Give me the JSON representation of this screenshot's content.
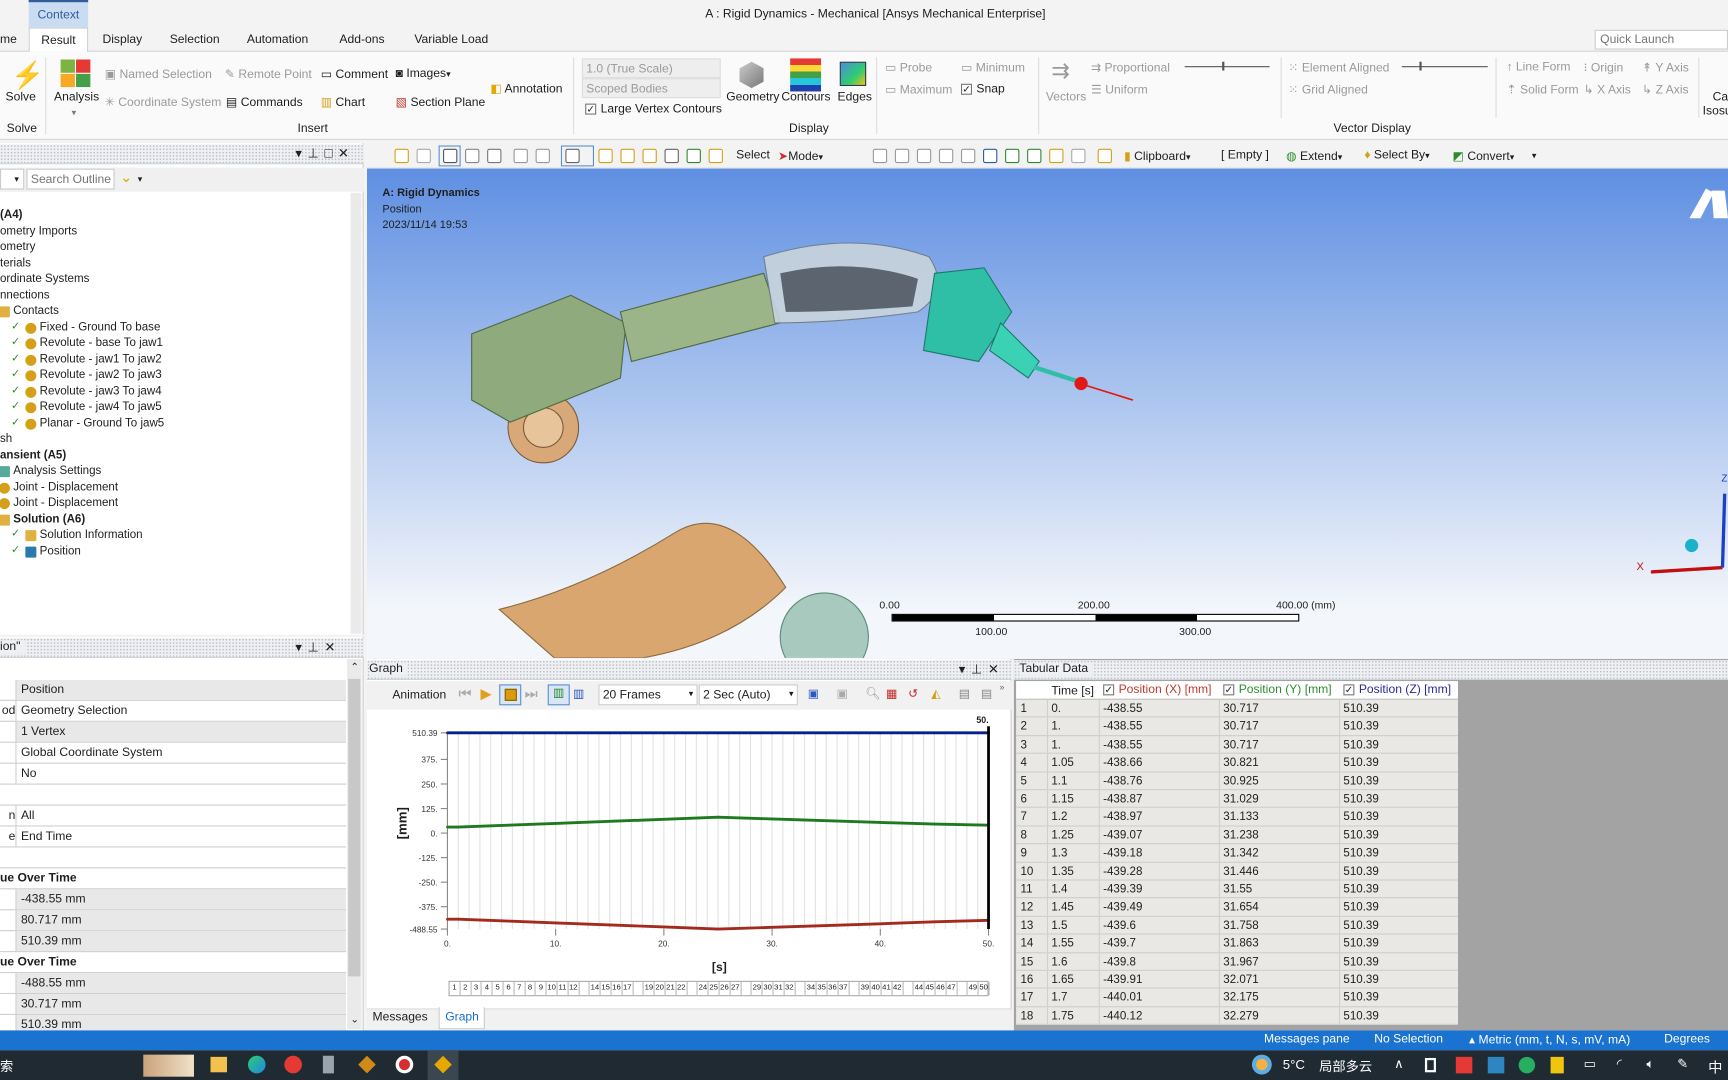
{
  "window": {
    "title": "A : Rigid Dynamics - Mechanical [Ansys Mechanical Enterprise]",
    "context_tab": "Context",
    "quick_launch_placeholder": "Quick Launch"
  },
  "ribbon_tabs": [
    "me",
    "Result",
    "Display",
    "Selection",
    "Automation",
    "Add-ons",
    "Variable Load"
  ],
  "ribbon": {
    "solve": "Solve",
    "solve_group": "Solve",
    "analysis": "Analysis",
    "named_selection": "Named Selection",
    "coordinate_system": "Coordinate System",
    "remote_point": "Remote Point",
    "commands": "Commands",
    "comment": "Comment",
    "chart": "Chart",
    "images": "Images",
    "section_plane": "Section Plane",
    "annotation": "Annotation",
    "insert_group": "Insert",
    "scale": "1.0 (True Scale)",
    "scoped_bodies": "Scoped Bodies",
    "large_vertex": "Large Vertex Contours",
    "geometry": "Geometry",
    "contours": "Contours",
    "edges": "Edges",
    "display_group": "Display",
    "probe": "Probe",
    "maximum": "Maximum",
    "minimum": "Minimum",
    "snap": "Snap",
    "vectors": "Vectors",
    "proportional": "Proportional",
    "uniform": "Uniform",
    "element_aligned": "Element Aligned",
    "grid_aligned": "Grid Aligned",
    "vector_display_group": "Vector Display",
    "line_form": "Line Form",
    "solid_form": "Solid Form",
    "origin": "Origin",
    "x_axis": "X Axis",
    "y_axis": "Y Axis",
    "z_axis": "Z Axis",
    "cap_1": "Ca",
    "cap_2": "Isosu"
  },
  "toolbar": {
    "select": "Select",
    "mode": "Mode",
    "clipboard": "Clipboard",
    "empty": "[ Empty ]",
    "extend": "Extend",
    "select_by": "Select By",
    "convert": "Convert"
  },
  "outline": {
    "search_placeholder": "Search Outline",
    "items": [
      {
        "label": "(A4)",
        "level": 0,
        "bold": true
      },
      {
        "label": "ometry Imports",
        "level": 0
      },
      {
        "label": "ometry",
        "level": 0
      },
      {
        "label": "terials",
        "level": 0
      },
      {
        "label": "ordinate Systems",
        "level": 0
      },
      {
        "label": "nnections",
        "level": 0
      },
      {
        "label": "Contacts",
        "level": 1,
        "icon": "folder"
      },
      {
        "label": "Fixed - Ground To base",
        "level": 2,
        "icon": "joint"
      },
      {
        "label": "Revolute - base To jaw1",
        "level": 2,
        "icon": "joint"
      },
      {
        "label": "Revolute - jaw1 To jaw2",
        "level": 2,
        "icon": "joint"
      },
      {
        "label": "Revolute - jaw2 To jaw3",
        "level": 2,
        "icon": "joint"
      },
      {
        "label": "Revolute - jaw3 To jaw4",
        "level": 2,
        "icon": "joint"
      },
      {
        "label": "Revolute - jaw4 To jaw5",
        "level": 2,
        "icon": "joint"
      },
      {
        "label": "Planar - Ground To jaw5",
        "level": 2,
        "icon": "joint"
      },
      {
        "label": "sh",
        "level": 0
      },
      {
        "label": "ansient (A5)",
        "level": 0,
        "bold": true
      },
      {
        "label": "Analysis Settings",
        "level": 1,
        "icon": "settings"
      },
      {
        "label": "Joint - Displacement",
        "level": 1,
        "icon": "joint"
      },
      {
        "label": "Joint - Displacement",
        "level": 1,
        "icon": "joint"
      },
      {
        "label": "Solution (A6)",
        "level": 1,
        "bold": true,
        "icon": "folder"
      },
      {
        "label": "Solution Information",
        "level": 2,
        "icon": "info"
      },
      {
        "label": "Position",
        "level": 2,
        "icon": "result",
        "selected": true
      }
    ]
  },
  "details": {
    "title": "ion\"",
    "rows": [
      {
        "label": "",
        "value": "Position",
        "shade": true
      },
      {
        "label": "od",
        "value": "Geometry Selection"
      },
      {
        "label": "",
        "value": "1 Vertex",
        "shade": true
      },
      {
        "label": "",
        "value": "Global Coordinate System"
      },
      {
        "label": "",
        "value": "No"
      },
      {
        "label": "",
        "value": "",
        "blank": true
      },
      {
        "label": "n",
        "value": "All"
      },
      {
        "label": "e",
        "value": "End Time"
      },
      {
        "label": "",
        "value": "",
        "blank": true
      },
      {
        "label": "ue Over Time",
        "header": true
      },
      {
        "label": "",
        "value": "-438.55 mm",
        "shade": true
      },
      {
        "label": "",
        "value": "80.717 mm",
        "shade": true
      },
      {
        "label": "",
        "value": "510.39 mm",
        "shade": true
      },
      {
        "label": "ue Over Time",
        "header": true
      },
      {
        "label": "",
        "value": "-488.55 mm",
        "shade": true
      },
      {
        "label": "",
        "value": "30.717 mm",
        "shade": true
      },
      {
        "label": "",
        "value": "510.39 mm",
        "shade": true
      }
    ]
  },
  "viewport": {
    "title": "A: Rigid Dynamics",
    "subtitle": "Position",
    "date": "2023/11/14 19:53",
    "scale_top": [
      "0.00",
      "200.00",
      "400.00 (mm)"
    ],
    "scale_bottom": [
      "100.00",
      "300.00"
    ],
    "axis_x": "X",
    "axis_z": "Z"
  },
  "graph": {
    "title": "Graph",
    "animation": "Animation",
    "frames": "20 Frames",
    "duration": "2 Sec (Auto)",
    "tabs": [
      "Messages",
      "Graph"
    ],
    "frame_numbers": [
      "1",
      "2",
      "3",
      "4",
      "5",
      "6",
      "7",
      "8",
      "9",
      "10",
      "11",
      "12",
      "",
      "14",
      "15",
      "16",
      "17",
      "",
      "19",
      "20",
      "21",
      "22",
      "",
      "24",
      "25",
      "26",
      "27",
      "",
      "29",
      "30",
      "31",
      "32",
      "",
      "34",
      "35",
      "36",
      "37",
      "",
      "39",
      "40",
      "41",
      "42",
      "",
      "44",
      "45",
      "46",
      "47",
      "",
      "49",
      "50"
    ]
  },
  "chart_data": {
    "type": "line",
    "xlabel": "[s]",
    "ylabel": "[mm]",
    "xlim": [
      0,
      50
    ],
    "ylim": [
      -488.55,
      510.39
    ],
    "x_ticks": [
      "0.",
      "10.",
      "20.",
      "30.",
      "40.",
      "50."
    ],
    "y_ticks": [
      "510.39",
      "375.",
      "250.",
      "125.",
      "0.",
      "-125.",
      "-250.",
      "-375.",
      "-488.55"
    ],
    "cursor_label": "50.",
    "x": [
      0,
      1,
      5,
      10,
      15,
      20,
      25,
      30,
      35,
      40,
      45,
      50
    ],
    "series": [
      {
        "color": "#0a1f8a",
        "values": [
          510.39,
          510.39,
          510.39,
          510.39,
          510.39,
          510.39,
          510.39,
          510.39,
          510.39,
          510.39,
          510.39,
          510.39
        ]
      },
      {
        "color": "#1f7a1f",
        "values": [
          30.717,
          30.717,
          39.0,
          49.4,
          59.8,
          70.2,
          80.717,
          72,
          63,
          54,
          46,
          40
        ]
      },
      {
        "color": "#a52a1e",
        "values": [
          -438.55,
          -438.55,
          -446.9,
          -457.3,
          -467.7,
          -478.1,
          -488.55,
          -480,
          -471,
          -462,
          -452,
          -444
        ]
      }
    ]
  },
  "tabular": {
    "title": "Tabular Data",
    "columns": [
      "Time [s]",
      "Position (X) [mm]",
      "Position (Y) [mm]",
      "Position (Z) [mm]"
    ],
    "column_colors": [
      "#222222",
      "#c0392b",
      "#2e8b2e",
      "#2a2a9a"
    ],
    "rows": [
      [
        "1",
        "0.",
        "-438.55",
        "30.717",
        "510.39"
      ],
      [
        "2",
        "1.",
        "-438.55",
        "30.717",
        "510.39"
      ],
      [
        "3",
        "1.",
        "-438.55",
        "30.717",
        "510.39"
      ],
      [
        "4",
        "1.05",
        "-438.66",
        "30.821",
        "510.39"
      ],
      [
        "5",
        "1.1",
        "-438.76",
        "30.925",
        "510.39"
      ],
      [
        "6",
        "1.15",
        "-438.87",
        "31.029",
        "510.39"
      ],
      [
        "7",
        "1.2",
        "-438.97",
        "31.133",
        "510.39"
      ],
      [
        "8",
        "1.25",
        "-439.07",
        "31.238",
        "510.39"
      ],
      [
        "9",
        "1.3",
        "-439.18",
        "31.342",
        "510.39"
      ],
      [
        "10",
        "1.35",
        "-439.28",
        "31.446",
        "510.39"
      ],
      [
        "11",
        "1.4",
        "-439.39",
        "31.55",
        "510.39"
      ],
      [
        "12",
        "1.45",
        "-439.49",
        "31.654",
        "510.39"
      ],
      [
        "13",
        "1.5",
        "-439.6",
        "31.758",
        "510.39"
      ],
      [
        "14",
        "1.55",
        "-439.7",
        "31.863",
        "510.39"
      ],
      [
        "15",
        "1.6",
        "-439.8",
        "31.967",
        "510.39"
      ],
      [
        "16",
        "1.65",
        "-439.91",
        "32.071",
        "510.39"
      ],
      [
        "17",
        "1.7",
        "-440.01",
        "32.175",
        "510.39"
      ],
      [
        "18",
        "1.75",
        "-440.12",
        "32.279",
        "510.39"
      ]
    ]
  },
  "status": {
    "messages": "Messages pane",
    "selection": "No Selection",
    "units": "Metric (mm, t, N, s, mV, mA)",
    "angle": "Degrees"
  },
  "taskbar": {
    "search_fragment": "索",
    "temperature": "5°C",
    "weather": "局部多云",
    "ime": "中"
  },
  "colors": {
    "accent": "#1a6fc9",
    "status_bar": "#1a73d0",
    "taskbar": "#1f2a33"
  }
}
